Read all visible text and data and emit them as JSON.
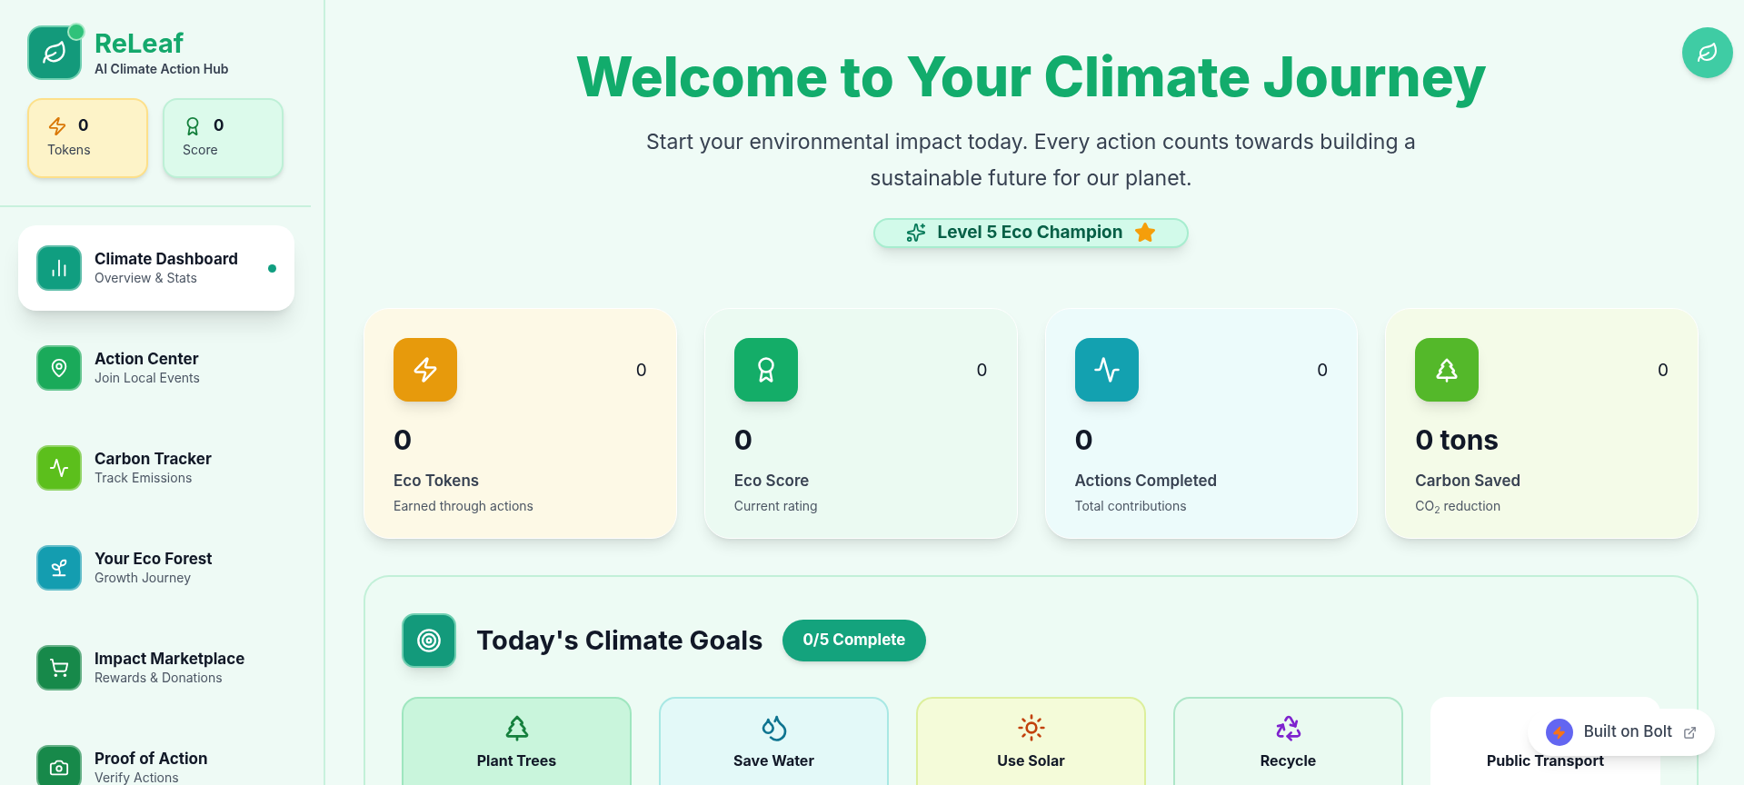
{
  "brand": {
    "name": "ReLeaf",
    "tagline": "AI Climate Action Hub",
    "online": true
  },
  "mini_stats": [
    {
      "kind": "tokens",
      "value": "0",
      "label": "Tokens"
    },
    {
      "kind": "score",
      "value": "0",
      "label": "Score"
    }
  ],
  "nav": [
    {
      "kind": "dashboard",
      "title": "Climate Dashboard",
      "subtitle": "Overview & Stats",
      "selected": true,
      "color": "#109e80"
    },
    {
      "kind": "pin",
      "title": "Action Center",
      "subtitle": "Join Local Events",
      "selected": false,
      "color": "#1aaa5a"
    },
    {
      "kind": "pulse",
      "title": "Carbon Tracker",
      "subtitle": "Track Emissions",
      "selected": false,
      "color": "#5cbf1c"
    },
    {
      "kind": "sprout",
      "title": "Your Eco Forest",
      "subtitle": "Growth Journey",
      "selected": false,
      "color": "#149db0"
    },
    {
      "kind": "cart",
      "title": "Impact Marketplace",
      "subtitle": "Rewards & Donations",
      "selected": false,
      "color": "#17894a"
    },
    {
      "kind": "camera",
      "title": "Proof of Action",
      "subtitle": "Verify Actions",
      "selected": false,
      "color": "#17894a"
    }
  ],
  "hero": {
    "title": "Welcome to Your Climate Journey",
    "subtitle": "Start your environmental impact today. Every action counts towards building a sustainable future for our planet.",
    "badge": "Level 5 Eco Champion"
  },
  "stats": [
    {
      "kind": "tokens",
      "corner": "0",
      "value": "0",
      "label": "Eco Tokens",
      "caption": "Earned through actions",
      "color": "#e79a0c"
    },
    {
      "kind": "score",
      "corner": "0",
      "value": "0",
      "label": "Eco Score",
      "caption": "Current rating",
      "color": "#14ad68"
    },
    {
      "kind": "pulse",
      "corner": "0",
      "value": "0",
      "label": "Actions Completed",
      "caption": "Total contributions",
      "color": "#13a1b0"
    },
    {
      "kind": "tree",
      "corner": "0",
      "value": "0 tons",
      "label": "Carbon Saved",
      "caption": "CO$_{2}$ reduction",
      "color": "#54b82a"
    }
  ],
  "goals": {
    "title": "Today's Climate Goals",
    "progress": "0/5 Complete",
    "items": [
      {
        "kind": "tree",
        "label": "Plant Trees",
        "color": "#15803d"
      },
      {
        "kind": "water",
        "label": "Save Water",
        "color": "#0e7490"
      },
      {
        "kind": "sun",
        "label": "Use Solar",
        "color": "#c2410c"
      },
      {
        "kind": "recycle",
        "label": "Recycle",
        "color": "#7e22ce"
      },
      {
        "kind": "covered",
        "label": "Public Transport"
      }
    ]
  },
  "bolt_badge": "Built on Bolt"
}
